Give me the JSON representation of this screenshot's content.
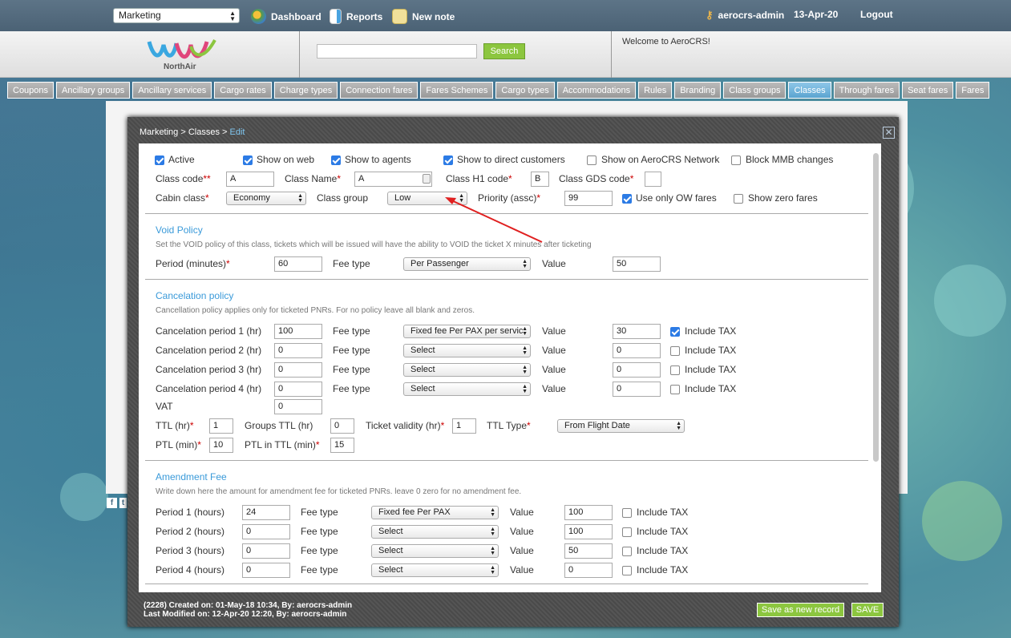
{
  "topbar": {
    "market": "Marketing",
    "dashboard": "Dashboard",
    "reports": "Reports",
    "new_note": "New note",
    "user": "aerocrs-admin",
    "date": "13-Apr-20",
    "logout": "Logout"
  },
  "header": {
    "logo_text": "NorthAir",
    "search_button": "Search",
    "search_value": "",
    "welcome": "Welcome to AeroCRS!"
  },
  "tabs": [
    "Coupons",
    "Ancillary groups",
    "Ancillary services",
    "Cargo rates",
    "Charge types",
    "Connection fares",
    "Fares Schemes",
    "Cargo types",
    "Accommodations",
    "Rules",
    "Branding",
    "Class groups",
    "Classes",
    "Through fares",
    "Seat fares",
    "Fares"
  ],
  "active_tab": "Classes",
  "modal": {
    "bc_path": "Marketing > Classes > ",
    "bc_current": "Edit",
    "checks": {
      "active": "Active",
      "show_web": "Show on web",
      "show_agents": "Show to agents",
      "show_direct": "Show to direct customers",
      "show_network": "Show on AeroCRS Network",
      "block_mmb": "Block MMB changes"
    },
    "class_code_label": "Class code",
    "class_code": "A",
    "class_name_label": "Class Name",
    "class_name": "A",
    "h1_label": "Class H1 code",
    "h1": "B",
    "gds_label": "Class GDS code",
    "gds": "",
    "cabin_label": "Cabin class",
    "cabin": "Economy",
    "group_label": "Class group",
    "group": "Low",
    "priority_label": "Priority (assc)",
    "priority": "99",
    "ow_label": "Use only OW fares",
    "zero_label": "Show zero fares",
    "void": {
      "title": "Void Policy",
      "note": "Set the VOID policy of this class, tickets which will be issued will have the ability to VOID the ticket X minutes after ticketing",
      "period_label": "Period (minutes)",
      "period": "60",
      "fee_label": "Fee type",
      "fee": "Per Passenger",
      "value_label": "Value",
      "value": "50"
    },
    "cancel": {
      "title": "Cancelation policy",
      "note": "Cancellation policy applies only for ticketed PNRs. For no policy leave all blank and zeros.",
      "rows": [
        {
          "label": "Cancelation period 1 (hr)",
          "period": "100",
          "fee": "Fixed fee Per PAX per servic",
          "value": "30"
        },
        {
          "label": "Cancelation period 2 (hr)",
          "period": "0",
          "fee": "Select",
          "value": "0"
        },
        {
          "label": "Cancelation period 3 (hr)",
          "period": "0",
          "fee": "Select",
          "value": "0"
        },
        {
          "label": "Cancelation period 4 (hr)",
          "period": "0",
          "fee": "Select",
          "value": "0"
        }
      ],
      "fee_label": "Fee type",
      "value_label": "Value",
      "tax_label": "Include TAX",
      "vat_label": "VAT",
      "vat": "0",
      "ttl_label": "TTL (hr)",
      "ttl": "1",
      "groups_ttl_label": "Groups TTL (hr)",
      "groups_ttl": "0",
      "validity_label": "Ticket validity (hr)",
      "validity": "1",
      "ttl_type_label": "TTL Type",
      "ttl_type": "From Flight Date",
      "ptl_label": "PTL (min)",
      "ptl": "10",
      "ptl_in_ttl_label": "PTL in TTL (min)",
      "ptl_in_ttl": "15"
    },
    "amend": {
      "title": "Amendment Fee",
      "note": "Write down here the amount for amendment fee for ticketed PNRs. leave 0 zero for no amendment fee.",
      "rows": [
        {
          "label": "Period 1 (hours)",
          "period": "24",
          "fee": "Fixed fee Per PAX",
          "value": "100"
        },
        {
          "label": "Period 2 (hours)",
          "period": "0",
          "fee": "Select",
          "value": "100"
        },
        {
          "label": "Period 3 (hours)",
          "period": "0",
          "fee": "Select",
          "value": "50"
        },
        {
          "label": "Period 4 (hours)",
          "period": "0",
          "fee": "Select",
          "value": "0"
        }
      ]
    },
    "footer": {
      "created": "(2228) Created on: 01-May-18 10:34, By: aerocrs-admin",
      "modified": "Last Modified on: 12-Apr-20 12:20, By: aerocrs-admin",
      "save_new": "Save as new record",
      "save": "SAVE"
    }
  }
}
